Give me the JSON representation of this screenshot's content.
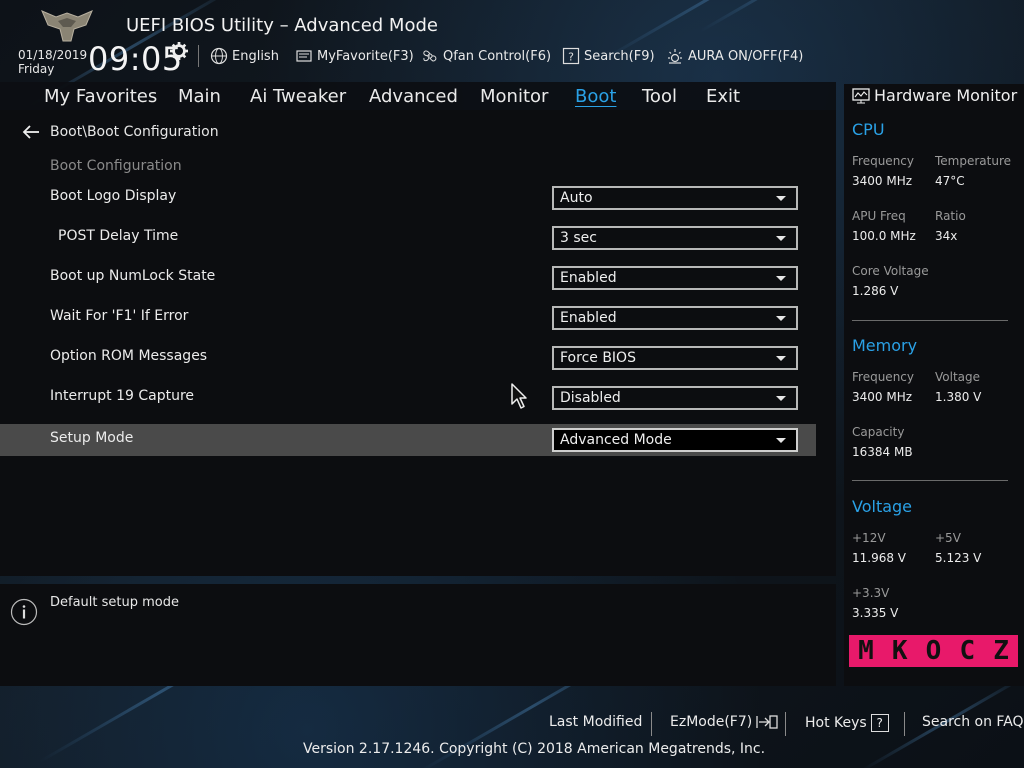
{
  "app": {
    "title": "UEFI BIOS Utility – Advanced Mode",
    "date": "01/18/2019",
    "day": "Friday",
    "time": "09:05"
  },
  "header": {
    "buttons": [
      {
        "label": "English",
        "icon": "globe-icon"
      },
      {
        "label": "MyFavorite(F3)",
        "icon": "favorite-icon"
      },
      {
        "label": "Qfan Control(F6)",
        "icon": "fan-icon"
      },
      {
        "label": "Search(F9)",
        "icon": "search-question-icon"
      },
      {
        "label": "AURA ON/OFF(F4)",
        "icon": "aura-icon"
      }
    ]
  },
  "nav": {
    "tabs": [
      "My Favorites",
      "Main",
      "Ai Tweaker",
      "Advanced",
      "Monitor",
      "Boot",
      "Tool",
      "Exit"
    ],
    "active": "Boot"
  },
  "main": {
    "breadcrumb": "Boot\\Boot Configuration",
    "section_title": "Boot Configuration",
    "settings": [
      {
        "label": "Boot Logo Display",
        "value": "Auto"
      },
      {
        "label": "POST Delay Time",
        "value": "3 sec"
      },
      {
        "label": "Boot up NumLock State",
        "value": "Enabled"
      },
      {
        "label": "Wait For 'F1' If Error",
        "value": "Enabled"
      },
      {
        "label": "Option ROM Messages",
        "value": "Force BIOS"
      },
      {
        "label": "Interrupt 19 Capture",
        "value": "Disabled"
      },
      {
        "label": "Setup Mode",
        "value": "Advanced Mode"
      }
    ],
    "selected": "Setup Mode"
  },
  "help": {
    "text": "Default setup mode"
  },
  "hardware_monitor": {
    "title": "Hardware Monitor",
    "cpu": {
      "heading": "CPU",
      "frequency_label": "Frequency",
      "frequency": "3400 MHz",
      "temperature_label": "Temperature",
      "temperature": "47°C",
      "apu_label": "APU Freq",
      "apu": "100.0 MHz",
      "ratio_label": "Ratio",
      "ratio": "34x",
      "core_voltage_label": "Core Voltage",
      "core_voltage": "1.286 V"
    },
    "memory": {
      "heading": "Memory",
      "frequency_label": "Frequency",
      "frequency": "3400 MHz",
      "voltage_label": "Voltage",
      "voltage": "1.380 V",
      "capacity_label": "Capacity",
      "capacity": "16384 MB"
    },
    "voltage": {
      "heading": "Voltage",
      "v12_label": "+12V",
      "v12": "11.968 V",
      "v5_label": "+5V",
      "v5": "5.123 V",
      "v33_label": "+3.3V",
      "v33": "3.335 V"
    },
    "brand_letters": [
      "M",
      "K",
      "O",
      "C",
      "Z"
    ],
    "brand_color": "#e8196a"
  },
  "footer": {
    "last_modified": "Last Modified",
    "ezmode": "EzMode(F7)",
    "hotkeys": "Hot Keys",
    "hotkeys_key": "?",
    "search_faq": "Search on FAQ",
    "copyright": "Version 2.17.1246. Copyright (C) 2018 American Megatrends, Inc."
  },
  "colors": {
    "accent": "#2aa1e6",
    "highlight_row": "#4a4a4a"
  }
}
